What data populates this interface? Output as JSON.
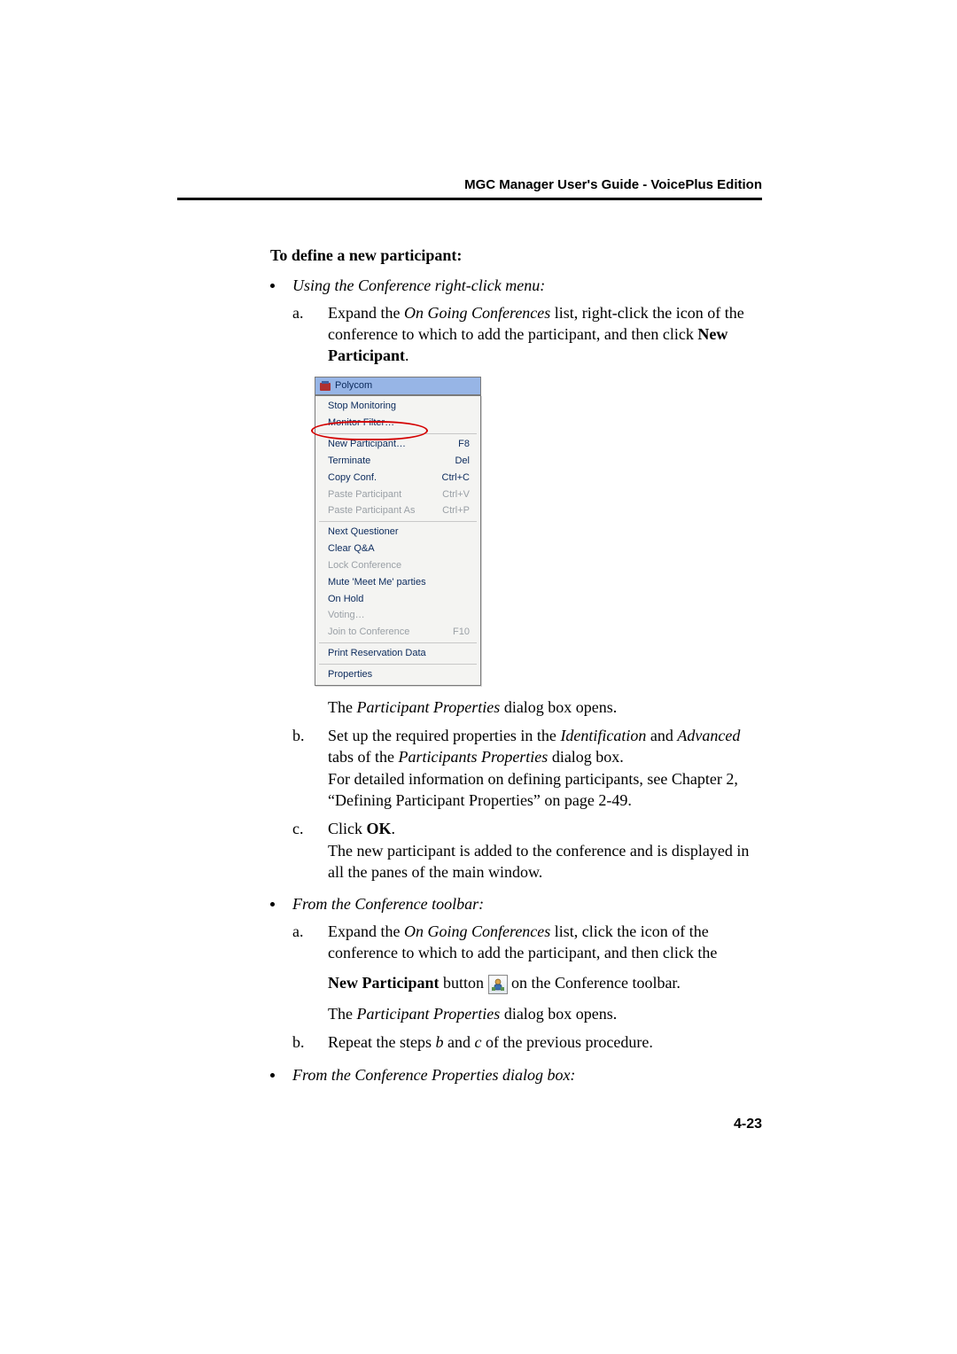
{
  "header": {
    "running_head": "MGC Manager User's Guide - VoicePlus Edition"
  },
  "page_number": "4-23",
  "section": {
    "heading": "To define a new participant:"
  },
  "proc1": {
    "intro": "Using the Conference right-click menu:",
    "a_marker": "a.",
    "a_part1": "Expand the ",
    "a_italic1": "On Going Conferences",
    "a_part2": " list, right-click the icon of the conference to which to add the participant, and then click ",
    "a_bold": "New Participant",
    "a_part3": ".",
    "after_fig": "The ",
    "after_fig_italic": "Participant Properties",
    "after_fig_tail": " dialog box opens.",
    "b_marker": "b.",
    "b_part1": "Set up the required properties in the ",
    "b_italic1": "Identification",
    "b_mid": " and ",
    "b_italic2": "Advanced",
    "b_part2": " tabs of the ",
    "b_italic3": "Participants Properties",
    "b_part3": " dialog box.",
    "b_line2": "For detailed information on defining participants, see Chapter 2, “Defining Participant Properties” on page 2-49.",
    "c_marker": "c.",
    "c_part1": "Click ",
    "c_bold": "OK",
    "c_part2": ".",
    "c_line2": "The new participant is added to the conference and is displayed in all the panes of the main window."
  },
  "proc2": {
    "intro": "From the Conference toolbar:",
    "a_marker": "a.",
    "a_part1": "Expand the ",
    "a_italic1": "On Going Conferences",
    "a_part2": " list, click the icon of the conference to which to add the participant, and then click the",
    "a_line2_bold": "New Participant",
    "a_line2_mid": " button ",
    "a_line2_tail": " on the Conference toolbar.",
    "a_result_lead": "The ",
    "a_result_italic": "Participant Properties",
    "a_result_tail": " dialog box opens.",
    "b_marker": "b.",
    "b_part1": "Repeat the steps ",
    "b_italic1": "b",
    "b_mid": " and ",
    "b_italic2": "c",
    "b_part2": " of the previous procedure."
  },
  "proc3": {
    "intro": "From the Conference Properties dialog box:"
  },
  "menu_fig": {
    "tree_label": "Polycom",
    "items": {
      "stop_monitoring": "Stop Monitoring",
      "monitor_filter": "Monitor Filter…",
      "new_participant": "New Participant…",
      "new_participant_key": "F8",
      "terminate": "Terminate",
      "terminate_key": "Del",
      "copy_conf": "Copy Conf.",
      "copy_conf_key": "Ctrl+C",
      "paste_participant": "Paste Participant",
      "paste_participant_key": "Ctrl+V",
      "paste_participant_as": "Paste Participant As",
      "paste_participant_as_key": "Ctrl+P",
      "next_questioner": "Next Questioner",
      "clear_qna": "Clear Q&A",
      "lock_conference": "Lock Conference",
      "mute_meet_me": "Mute 'Meet Me' parties",
      "on_hold": "On Hold",
      "voting": "Voting…",
      "join_to_conference": "Join to Conference",
      "join_to_conference_key": "F10",
      "print_reservation": "Print Reservation Data",
      "properties": "Properties"
    }
  }
}
